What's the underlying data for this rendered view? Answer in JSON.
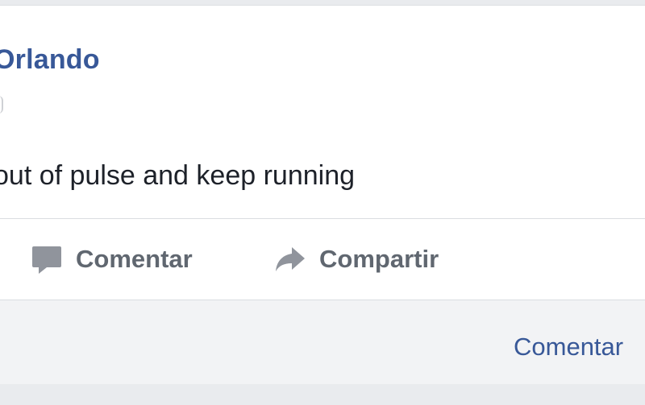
{
  "post": {
    "author": "Orlando",
    "text": "out of pulse and keep running"
  },
  "actions": {
    "comment_label": "Comentar",
    "comment_icon": "comment-icon",
    "share_label": "Compartir",
    "share_icon": "share-icon"
  },
  "comments_footer": {
    "comment_link": "Comentar"
  },
  "colors": {
    "author_link": "#385898",
    "post_text": "#1d2129",
    "action_text": "#606770",
    "action_icon": "#90949c",
    "footer_bg": "#f2f3f5"
  }
}
